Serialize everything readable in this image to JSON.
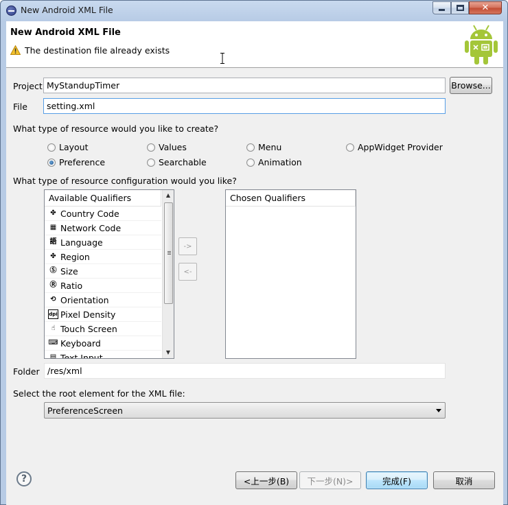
{
  "window": {
    "title": "New Android XML File"
  },
  "banner": {
    "title": "New Android XML File",
    "message": "The destination file already exists"
  },
  "form": {
    "project_label": "Project",
    "project_value": "MyStandupTimer",
    "browse_label": "Browse...",
    "file_label": "File",
    "file_value": "setting.xml",
    "resource_type_question": "What type of resource would you like to create?",
    "resource_types": [
      {
        "label": "Layout",
        "checked": false
      },
      {
        "label": "Values",
        "checked": false
      },
      {
        "label": "Menu",
        "checked": false
      },
      {
        "label": "AppWidget Provider",
        "checked": false
      },
      {
        "label": "Preference",
        "checked": true
      },
      {
        "label": "Searchable",
        "checked": false
      },
      {
        "label": "Animation",
        "checked": false
      }
    ],
    "config_question": "What type of resource configuration would you like?",
    "available_header": "Available Qualifiers",
    "available": [
      {
        "label": "Country Code",
        "icon": "country-code-icon"
      },
      {
        "label": "Network Code",
        "icon": "network-code-icon"
      },
      {
        "label": "Language",
        "icon": "language-icon"
      },
      {
        "label": "Region",
        "icon": "region-icon"
      },
      {
        "label": "Size",
        "icon": "size-icon"
      },
      {
        "label": "Ratio",
        "icon": "ratio-icon"
      },
      {
        "label": "Orientation",
        "icon": "orientation-icon"
      },
      {
        "label": "Pixel Density",
        "icon": "pixel-density-icon"
      },
      {
        "label": "Touch Screen",
        "icon": "touch-screen-icon"
      },
      {
        "label": "Keyboard",
        "icon": "keyboard-icon"
      },
      {
        "label": "Text Input",
        "icon": "text-input-icon"
      }
    ],
    "add_arrow": "->",
    "remove_arrow": "<-",
    "chosen_header": "Chosen Qualifiers",
    "folder_label": "Folder",
    "folder_value": "/res/xml",
    "root_question": "Select the root element for the XML file:",
    "root_value": "PreferenceScreen"
  },
  "footer": {
    "back": "<上一步(B)",
    "next": "下一步(N)>",
    "finish": "完成(F)",
    "cancel": "取消"
  },
  "colors": {
    "android_green": "#a4c639",
    "title_bar": "#c9daef",
    "dialog_bg": "#f0f0f0",
    "focus_border": "#569de5",
    "default_button": "#3c7fb1"
  }
}
